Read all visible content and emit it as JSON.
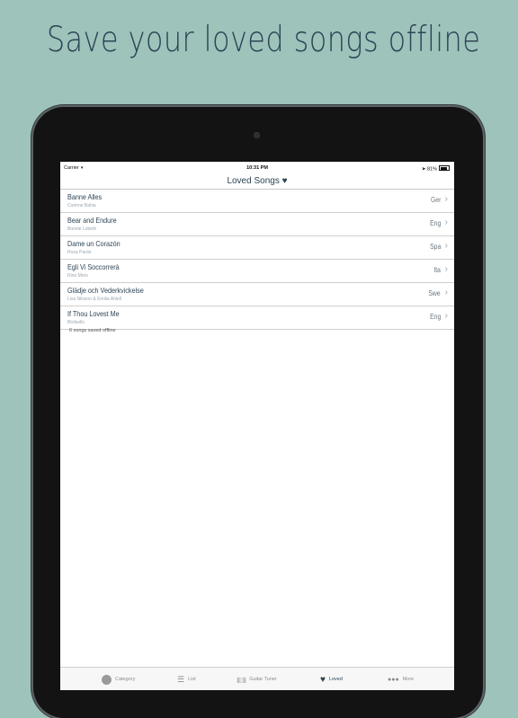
{
  "headline": "Save your loved songs offline",
  "status": {
    "carrier": "Carrier",
    "time": "10:31 PM",
    "battery": "81%"
  },
  "nav": {
    "title": "Loved Songs ♥"
  },
  "songs": [
    {
      "title": "Banne Alles",
      "artist": "Corinne Bahia",
      "lang": "Ger"
    },
    {
      "title": "Bear and Endure",
      "artist": "Bonnie Lobeth",
      "lang": "Eng"
    },
    {
      "title": "Dame un Corazón",
      "artist": "Rosa Pardo",
      "lang": "Spa"
    },
    {
      "title": "Egli Vi Soccorrerà",
      "artist": "Rino Mero",
      "lang": "Ita"
    },
    {
      "title": "Glädje och Vederkvickelse",
      "artist": "Lisa Nilsson & Emilia Ahlell",
      "lang": "Swe"
    },
    {
      "title": "If Thou Lovest Me",
      "artist": "Birdsells",
      "lang": "Eng"
    }
  ],
  "footer_note": "6 songs saved offline",
  "tabs": [
    {
      "label": "Category",
      "icon": "circle-icon"
    },
    {
      "label": "List",
      "icon": "list-icon"
    },
    {
      "label": "Guitar Tuner",
      "icon": "tuner-icon"
    },
    {
      "label": "Loved",
      "icon": "heart-icon",
      "active": true
    },
    {
      "label": "More",
      "icon": "more-dots-icon"
    }
  ],
  "colors": {
    "background": "#9dc3bb",
    "accent": "#2d4454",
    "device": "#131314"
  }
}
